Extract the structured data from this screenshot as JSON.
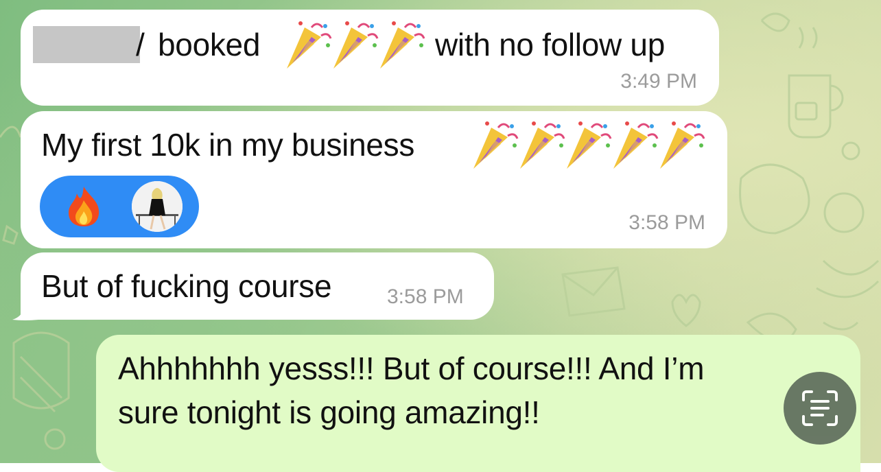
{
  "messages": {
    "msg1": {
      "text_prefix": "/",
      "text_main": "booked",
      "text_suffix": "with no follow up",
      "party_count": 3,
      "time": "3:49 PM"
    },
    "msg2": {
      "text": "My first 10k in my business",
      "party_count": 5,
      "time": "3:58 PM",
      "reactions": [
        {
          "icon": "fire-emoji"
        },
        {
          "icon": "user-avatar"
        }
      ]
    },
    "msg3": {
      "text": "But of fucking course",
      "time": "3:58 PM"
    },
    "msg4": {
      "line1": "Ahhhhhhh yesss!!! But of course!!! And I’m",
      "line2": "sure tonight is going amazing!!"
    }
  },
  "controls": {
    "scan_button": "live-text-icon"
  },
  "colors": {
    "incoming": "#ffffff",
    "outgoing": "#e1fbc6",
    "reaction_blue": "#2f8cf5",
    "time_gray": "#9b9b9b"
  }
}
